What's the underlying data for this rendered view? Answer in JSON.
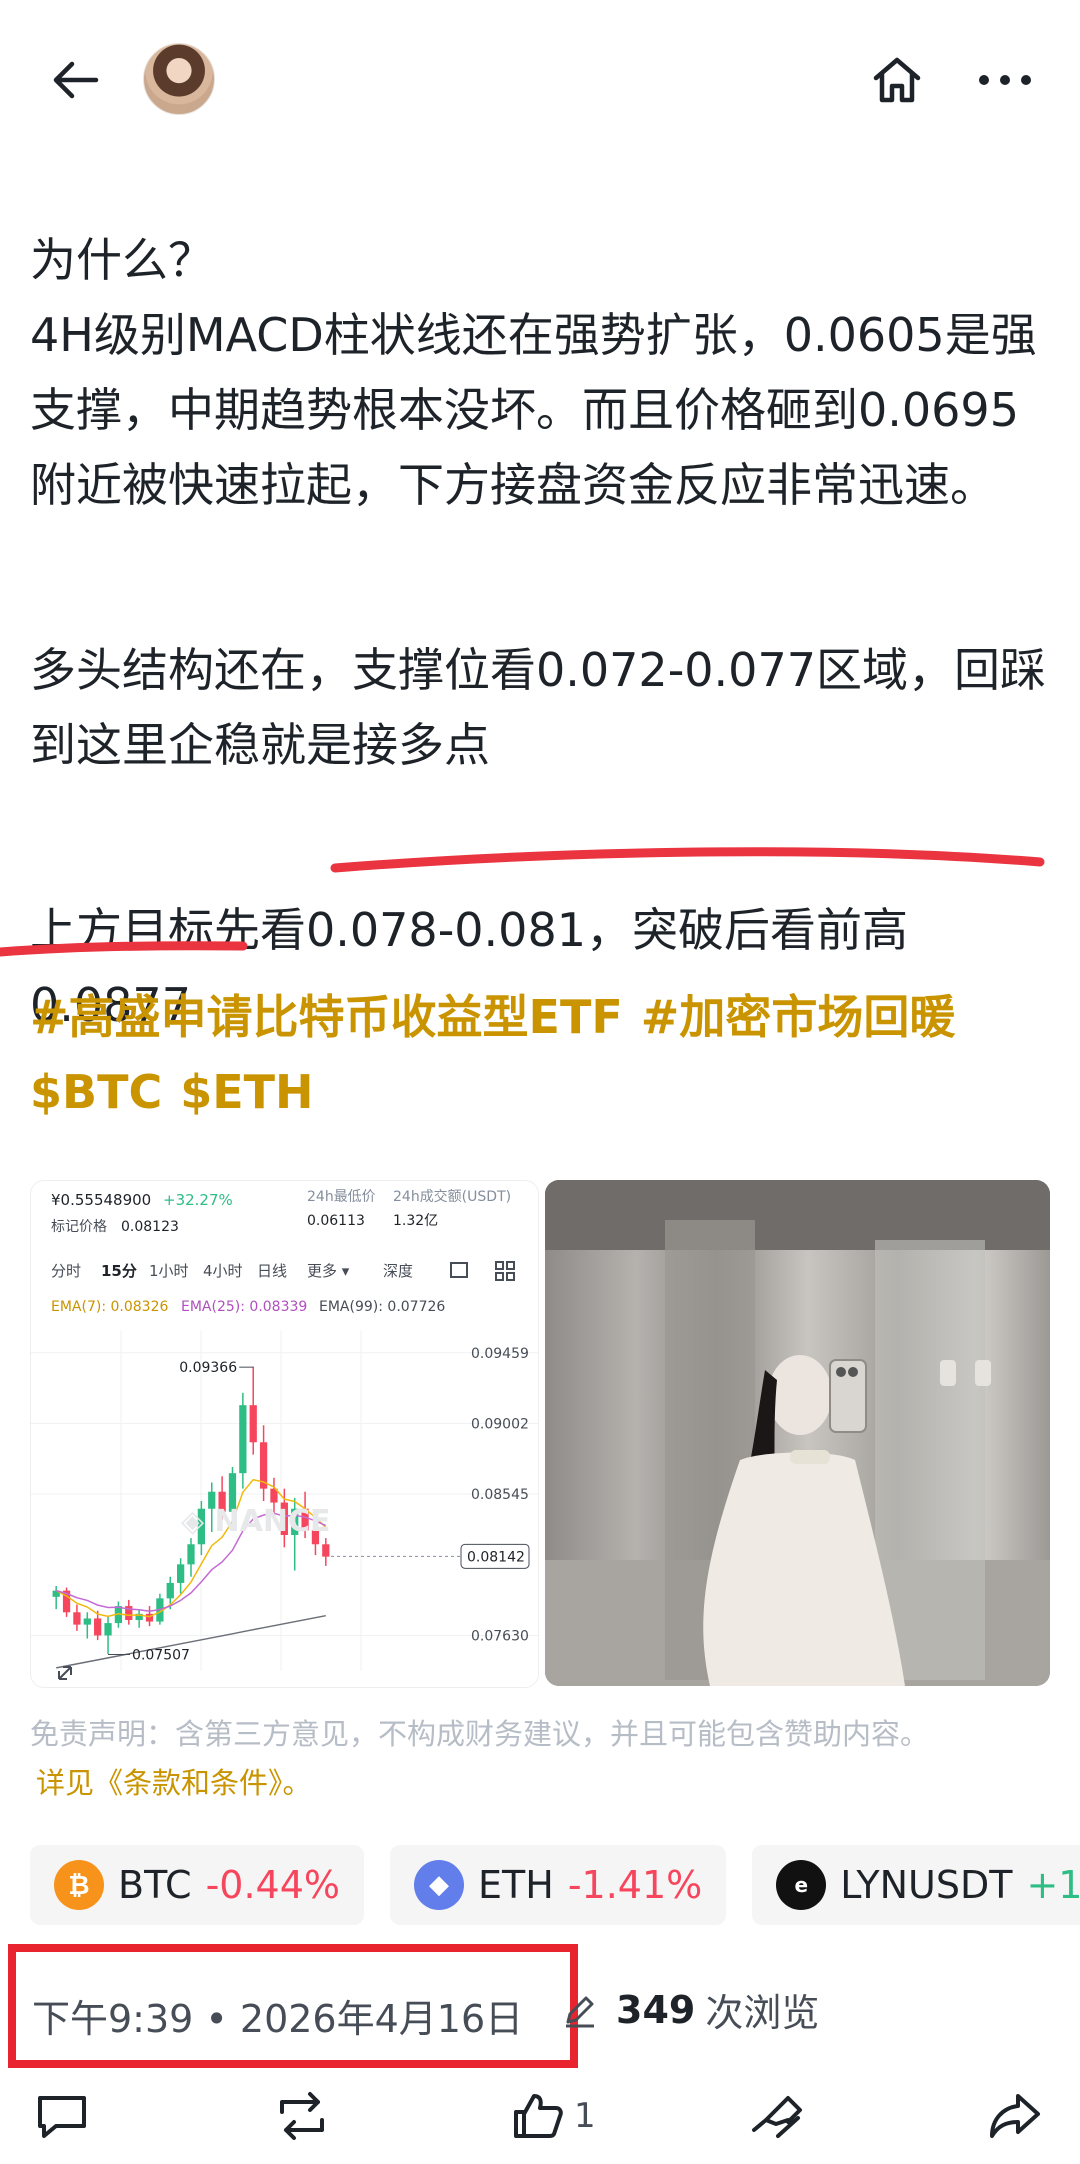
{
  "post": {
    "paragraphs": [
      "为什么？\n4H级别MACD柱状线还在强势扩张，0.0605是强支撑，中期趋势根本没坏。而且价格砸到0.0695附近被快速拉起，下方接盘资金反应非常迅速。",
      "多头结构还在，支撑位看0.072-0.077区域，回踩到这里企稳就是接多点",
      "上方目标先看0.078-0.081，突破后看前高0.0877"
    ],
    "hashtags": [
      "#高盛申请比特币收益型ETF",
      "#加密市场回暖",
      "$BTC",
      "$ETH"
    ]
  },
  "chart": {
    "price_line": "¥0.55548900",
    "change": "+32.27%",
    "mark_price_label": "标记价格",
    "mark_price": "0.08123",
    "low_label": "24h最低价",
    "low_value": "0.06113",
    "volume_label": "24h成交额(USDT)",
    "volume_value": "1.32亿",
    "tabs": [
      "分时",
      "15分",
      "1小时",
      "4小时",
      "日线",
      "更多 ▾",
      "深度"
    ],
    "ema7": "EMA(7): 0.08326",
    "ema25": "EMA(25): 0.08339",
    "ema99": "EMA(99): 0.07726",
    "y_ticks": [
      "0.09459",
      "0.09002",
      "0.08545",
      "0.08142",
      "0.07630"
    ],
    "high_label": "0.09366",
    "low_label_point": "0.07507",
    "current_price": "0.08142"
  },
  "chart_data": {
    "type": "candlestick",
    "interval": "15分",
    "ylim": [
      0.074,
      0.096
    ],
    "candles": [
      [
        0.0788,
        0.0795,
        0.078,
        0.0792
      ],
      [
        0.0792,
        0.0794,
        0.0775,
        0.0778
      ],
      [
        0.0778,
        0.0783,
        0.0766,
        0.077
      ],
      [
        0.077,
        0.0778,
        0.0761,
        0.0774
      ],
      [
        0.0774,
        0.0779,
        0.076,
        0.0763
      ],
      [
        0.0763,
        0.0775,
        0.0751,
        0.0771
      ],
      [
        0.0771,
        0.0785,
        0.0768,
        0.0782
      ],
      [
        0.0782,
        0.0786,
        0.077,
        0.0773
      ],
      [
        0.0773,
        0.078,
        0.0768,
        0.0777
      ],
      [
        0.0777,
        0.0782,
        0.0769,
        0.0772
      ],
      [
        0.0772,
        0.079,
        0.077,
        0.0787
      ],
      [
        0.0787,
        0.0801,
        0.078,
        0.0797
      ],
      [
        0.0797,
        0.0813,
        0.079,
        0.0809
      ],
      [
        0.0809,
        0.0826,
        0.0801,
        0.0822
      ],
      [
        0.0822,
        0.085,
        0.0815,
        0.0845
      ],
      [
        0.0845,
        0.0862,
        0.083,
        0.0856
      ],
      [
        0.0856,
        0.0866,
        0.0838,
        0.0843
      ],
      [
        0.0843,
        0.0872,
        0.084,
        0.0868
      ],
      [
        0.0868,
        0.092,
        0.0858,
        0.0912
      ],
      [
        0.0912,
        0.0937,
        0.088,
        0.0888
      ],
      [
        0.0888,
        0.0899,
        0.085,
        0.0858
      ],
      [
        0.0858,
        0.0865,
        0.084,
        0.0849
      ],
      [
        0.0849,
        0.0858,
        0.082,
        0.0828
      ],
      [
        0.0828,
        0.0852,
        0.0805,
        0.0845
      ],
      [
        0.0845,
        0.0856,
        0.0826,
        0.0831
      ],
      [
        0.0831,
        0.084,
        0.0815,
        0.0822
      ],
      [
        0.0822,
        0.0826,
        0.0808,
        0.0814
      ]
    ]
  },
  "disclaimer": "免责声明：含第三方意见，不构成财务建议，并且可能包含赞助内容。",
  "terms_link": "详见《条款和条件》。",
  "coins": [
    {
      "symbol": "BTC",
      "change": "-0.44%",
      "color": "#f7931a",
      "icon": "btc-icon",
      "glyph": "₿",
      "dir": "neg"
    },
    {
      "symbol": "ETH",
      "change": "-1.41%",
      "color": "#627eea",
      "icon": "eth-icon",
      "glyph": "◆",
      "dir": "neg"
    },
    {
      "symbol": "LYNUSDT",
      "change": "+1.",
      "color": "#111111",
      "icon": "lyn-icon",
      "glyph": "e",
      "dir": "pos"
    }
  ],
  "meta": {
    "time": "下午9:39 • 2026年4月16日",
    "views_count": "349",
    "views_label": "次浏览"
  },
  "actions": {
    "like_count": "1"
  }
}
